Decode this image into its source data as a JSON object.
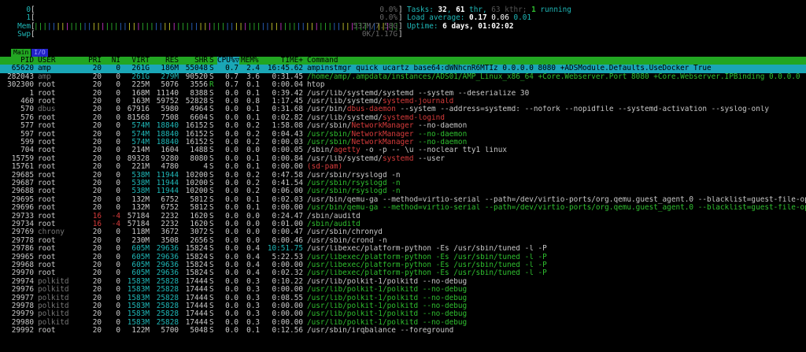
{
  "meters": [
    {
      "label": "0",
      "value": "0.0%",
      "kind": "cpu",
      "fill_fraction": 0.0,
      "bars": ""
    },
    {
      "label": "1",
      "value": "0.0%",
      "kind": "cpu",
      "fill_fraction": 0.0,
      "bars": ""
    },
    {
      "label": "Mem",
      "value": "532M/7.58G",
      "kind": "mem",
      "fill_fraction": 0.07,
      "bars": "||||||||||||||||||||||||||||||||||||||||||||||||||||||||||||||||||||||||||||||||||||||||||||||"
    },
    {
      "label": "Swp",
      "value": "0K/1.17G",
      "kind": "swp",
      "fill_fraction": 0.0,
      "bars": ""
    }
  ],
  "stats": {
    "tasks_label": "Tasks: ",
    "tasks_value": "32",
    "tasks_sep": ", ",
    "thr_value": "61",
    "thr_label": " thr, ",
    "kthr_value": "63",
    "kthr_label": " kthr; ",
    "running_value": "1",
    "running_label": " running",
    "load_label": "Load average: ",
    "load_1": "0.17",
    "load_5": "0.06",
    "load_15": "0.01",
    "uptime_label": "Uptime: ",
    "uptime_value": "6 days, 01:02:02"
  },
  "tabs": [
    {
      "label": "Main",
      "active": true
    },
    {
      "label": "I/O",
      "active": false
    }
  ],
  "columns": {
    "pid": "PID",
    "user": "USER",
    "pri": "PRI",
    "ni": "NI",
    "virt": "VIRT",
    "res": "RES",
    "shr": "SHR",
    "s": "S",
    "cpu": "CPU%▽",
    "mem": "MEM%",
    "time": "TIME+",
    "cmd": "Command"
  },
  "processes": [
    {
      "pid": "65620",
      "user": "amp",
      "pri": "20",
      "ni": "0",
      "virt": "261G",
      "res": "186M",
      "shr": "55048",
      "s": "S",
      "cpu": "0.7",
      "mem": "2.4",
      "time": "16:45.62",
      "cmd": "ampinstmgr quick ucartz base64:dWNhcnR6MTIz 0.0.0.0 8080 +ADSModule.Defaults.UseDocker True",
      "selected": true,
      "user_style": "",
      "virt_style": "",
      "cmd_style": ""
    },
    {
      "pid": "282043",
      "user": "amp",
      "pri": "20",
      "ni": "0",
      "virt": "261G",
      "res": "279M",
      "shr": "90520",
      "s": "S",
      "cpu": "0.7",
      "mem": "3.6",
      "time": "0:31.45",
      "cmd": "/home/amp/.ampdata/instances/ADS01/AMP_Linux_x86_64 +Core.Webserver.Port 8080 +Core.Webserver.IPBinding 0.0.0.0",
      "selected": false,
      "user_style": "dim",
      "virt_style": "cyan",
      "cmd_style": "green"
    },
    {
      "pid": "302300",
      "user": "root",
      "pri": "20",
      "ni": "0",
      "virt": "225M",
      "res": "5076",
      "shr": "3556",
      "s": "R",
      "cpu": "0.7",
      "mem": "0.1",
      "time": "0:00.04",
      "cmd": "htop",
      "selected": false,
      "user_style": "",
      "virt_style": "",
      "cmd_style": ""
    },
    {
      "pid": "1",
      "user": "root",
      "pri": "20",
      "ni": "0",
      "virt": "168M",
      "res": "11140",
      "shr": "8388",
      "s": "S",
      "cpu": "0.0",
      "mem": "0.1",
      "time": "0:39.42",
      "cmd": "/usr/lib/systemd/systemd --system --deserialize 30",
      "selected": false,
      "user_style": "",
      "virt_style": "",
      "cmd_style": ""
    },
    {
      "pid": "460",
      "user": "root",
      "pri": "20",
      "ni": "0",
      "virt": "163M",
      "res": "59752",
      "shr": "52828",
      "s": "S",
      "cpu": "0.0",
      "mem": "0.8",
      "time": "1:17.45",
      "cmd": "/usr/lib/systemd/systemd-journald",
      "selected": false,
      "user_style": "",
      "virt_style": "",
      "cmd_style": "redtail",
      "cmd_prefix": "/usr/lib/systemd/",
      "cmd_tail": "systemd-journald"
    },
    {
      "pid": "570",
      "user": "dbus",
      "pri": "20",
      "ni": "0",
      "virt": "67916",
      "res": "5980",
      "shr": "4964",
      "s": "S",
      "cpu": "0.0",
      "mem": "0.1",
      "time": "0:31.68",
      "cmd": "/usr/bin/dbus-daemon --system --address=systemd: --nofork --nopidfile --systemd-activation --syslog-only",
      "selected": false,
      "user_style": "dim",
      "virt_style": "",
      "cmd_style": "redmid",
      "cmd_prefix": "/usr/bin/",
      "cmd_tail": "dbus-daemon",
      "cmd_rest": " --system --address=systemd: --nofork --nopidfile --systemd-activation --syslog-only"
    },
    {
      "pid": "576",
      "user": "root",
      "pri": "20",
      "ni": "0",
      "virt": "81568",
      "res": "7508",
      "shr": "6604",
      "s": "S",
      "cpu": "0.0",
      "mem": "0.1",
      "time": "0:02.82",
      "cmd": "/usr/lib/systemd/systemd-logind",
      "selected": false,
      "user_style": "",
      "virt_style": "",
      "cmd_style": "redtail",
      "cmd_prefix": "/usr/lib/systemd/",
      "cmd_tail": "systemd-logind"
    },
    {
      "pid": "577",
      "user": "root",
      "pri": "20",
      "ni": "0",
      "virt": "574M",
      "res": "18840",
      "shr": "16152",
      "s": "S",
      "cpu": "0.0",
      "mem": "0.2",
      "time": "1:58.08",
      "cmd": "/usr/sbin/NetworkManager --no-daemon",
      "selected": false,
      "user_style": "",
      "virt_style": "cyan",
      "cmd_style": "redmid",
      "cmd_prefix": "/usr/sbin/",
      "cmd_tail": "NetworkManager",
      "cmd_rest": " --no-daemon"
    },
    {
      "pid": "597",
      "user": "root",
      "pri": "20",
      "ni": "0",
      "virt": "574M",
      "res": "18840",
      "shr": "16152",
      "s": "S",
      "cpu": "0.0",
      "mem": "0.2",
      "time": "0:04.43",
      "cmd": "/usr/sbin/NetworkManager --no-daemon",
      "selected": false,
      "user_style": "",
      "virt_style": "cyan",
      "cmd_style": "greenred",
      "cmd_prefix": "/usr/sbin/",
      "cmd_tail": "NetworkManager",
      "cmd_rest": " --no-daemon"
    },
    {
      "pid": "599",
      "user": "root",
      "pri": "20",
      "ni": "0",
      "virt": "574M",
      "res": "18840",
      "shr": "16152",
      "s": "S",
      "cpu": "0.0",
      "mem": "0.2",
      "time": "0:00.03",
      "cmd": "/usr/sbin/NetworkManager --no-daemon",
      "selected": false,
      "user_style": "",
      "virt_style": "cyan",
      "cmd_style": "greenred",
      "cmd_prefix": "/usr/sbin/",
      "cmd_tail": "NetworkManager",
      "cmd_rest": " --no-daemon"
    },
    {
      "pid": "704",
      "user": "root",
      "pri": "20",
      "ni": "0",
      "virt": "214M",
      "res": "1604",
      "shr": "1488",
      "s": "S",
      "cpu": "0.0",
      "mem": "0.0",
      "time": "0:00.05",
      "cmd": "/sbin/agetty -o -p -- \\u --noclear tty1 linux",
      "selected": false,
      "user_style": "",
      "virt_style": "",
      "cmd_style": "redmid",
      "cmd_prefix": "/sbin/",
      "cmd_tail": "agetty",
      "cmd_rest": " -o -p -- \\u --noclear tty1 linux"
    },
    {
      "pid": "15759",
      "user": "root",
      "pri": "20",
      "ni": "0",
      "virt": "89328",
      "res": "9280",
      "shr": "8080",
      "s": "S",
      "cpu": "0.0",
      "mem": "0.1",
      "time": "0:00.84",
      "cmd": "/usr/lib/systemd/systemd --user",
      "selected": false,
      "user_style": "",
      "virt_style": "",
      "cmd_style": "redmid",
      "cmd_prefix": "/usr/lib/systemd/",
      "cmd_tail": "systemd",
      "cmd_rest": " --user"
    },
    {
      "pid": "15761",
      "user": "root",
      "pri": "20",
      "ni": "0",
      "virt": "221M",
      "res": "4780",
      "shr": "4",
      "s": "S",
      "cpu": "0.0",
      "mem": "0.1",
      "time": "0:00.00",
      "cmd": "(sd-pam)",
      "selected": false,
      "user_style": "",
      "virt_style": "",
      "cmd_style": "red"
    },
    {
      "pid": "29685",
      "user": "root",
      "pri": "20",
      "ni": "0",
      "virt": "538M",
      "res": "11944",
      "shr": "10200",
      "s": "S",
      "cpu": "0.0",
      "mem": "0.2",
      "time": "0:47.58",
      "cmd": "/usr/sbin/rsyslogd -n",
      "selected": false,
      "user_style": "",
      "virt_style": "cyan",
      "cmd_style": ""
    },
    {
      "pid": "29687",
      "user": "root",
      "pri": "20",
      "ni": "0",
      "virt": "538M",
      "res": "11944",
      "shr": "10200",
      "s": "S",
      "cpu": "0.0",
      "mem": "0.2",
      "time": "0:41.54",
      "cmd": "/usr/sbin/rsyslogd -n",
      "selected": false,
      "user_style": "",
      "virt_style": "cyan",
      "cmd_style": "green"
    },
    {
      "pid": "29688",
      "user": "root",
      "pri": "20",
      "ni": "0",
      "virt": "538M",
      "res": "11944",
      "shr": "10200",
      "s": "S",
      "cpu": "0.0",
      "mem": "0.2",
      "time": "0:06.00",
      "cmd": "/usr/sbin/rsyslogd -n",
      "selected": false,
      "user_style": "",
      "virt_style": "cyan",
      "cmd_style": "green"
    },
    {
      "pid": "29695",
      "user": "root",
      "pri": "20",
      "ni": "0",
      "virt": "132M",
      "res": "6752",
      "shr": "5812",
      "s": "S",
      "cpu": "0.0",
      "mem": "0.1",
      "time": "0:02.03",
      "cmd": "/usr/bin/qemu-ga --method=virtio-serial --path=/dev/virtio-ports/org.qemu.guest_agent.0 --blacklist=guest-file-open",
      "selected": false,
      "user_style": "",
      "virt_style": "",
      "cmd_style": ""
    },
    {
      "pid": "29696",
      "user": "root",
      "pri": "20",
      "ni": "0",
      "virt": "132M",
      "res": "6752",
      "shr": "5812",
      "s": "S",
      "cpu": "0.0",
      "mem": "0.1",
      "time": "0:00.00",
      "cmd": "/usr/bin/qemu-ga --method=virtio-serial --path=/dev/virtio-ports/org.qemu.guest_agent.0 --blacklist=guest-file-open",
      "selected": false,
      "user_style": "",
      "virt_style": "",
      "cmd_style": "green"
    },
    {
      "pid": "29733",
      "user": "root",
      "pri": "16",
      "ni": "-4",
      "virt": "57184",
      "res": "2232",
      "shr": "1620",
      "s": "S",
      "cpu": "0.0",
      "mem": "0.0",
      "time": "0:24.47",
      "cmd": "/sbin/auditd",
      "selected": false,
      "user_style": "",
      "virt_style": "",
      "cmd_style": "",
      "ni_red": true
    },
    {
      "pid": "29734",
      "user": "root",
      "pri": "16",
      "ni": "-4",
      "virt": "57184",
      "res": "2232",
      "shr": "1620",
      "s": "S",
      "cpu": "0.0",
      "mem": "0.0",
      "time": "0:01.00",
      "cmd": "/sbin/auditd",
      "selected": false,
      "user_style": "",
      "virt_style": "",
      "cmd_style": "green",
      "ni_red": true
    },
    {
      "pid": "29769",
      "user": "chrony",
      "pri": "20",
      "ni": "0",
      "virt": "118M",
      "res": "3672",
      "shr": "3072",
      "s": "S",
      "cpu": "0.0",
      "mem": "0.0",
      "time": "0:00.47",
      "cmd": "/usr/sbin/chronyd",
      "selected": false,
      "user_style": "dim",
      "virt_style": "",
      "cmd_style": ""
    },
    {
      "pid": "29778",
      "user": "root",
      "pri": "20",
      "ni": "0",
      "virt": "230M",
      "res": "3508",
      "shr": "2656",
      "s": "S",
      "cpu": "0.0",
      "mem": "0.0",
      "time": "0:00.46",
      "cmd": "/usr/sbin/crond -n",
      "selected": false,
      "user_style": "",
      "virt_style": "",
      "cmd_style": ""
    },
    {
      "pid": "29786",
      "user": "root",
      "pri": "20",
      "ni": "0",
      "virt": "605M",
      "res": "29636",
      "shr": "15824",
      "s": "S",
      "cpu": "0.0",
      "mem": "0.4",
      "time": "10:51.75",
      "cmd": "/usr/libexec/platform-python -Es /usr/sbin/tuned -l -P",
      "selected": false,
      "user_style": "",
      "virt_style": "cyan",
      "cmd_style": "",
      "time_cyan": true
    },
    {
      "pid": "29965",
      "user": "root",
      "pri": "20",
      "ni": "0",
      "virt": "605M",
      "res": "29636",
      "shr": "15824",
      "s": "S",
      "cpu": "0.0",
      "mem": "0.4",
      "time": "5:22.53",
      "cmd": "/usr/libexec/platform-python -Es /usr/sbin/tuned -l -P",
      "selected": false,
      "user_style": "",
      "virt_style": "cyan",
      "cmd_style": "green"
    },
    {
      "pid": "29968",
      "user": "root",
      "pri": "20",
      "ni": "0",
      "virt": "605M",
      "res": "29636",
      "shr": "15824",
      "s": "S",
      "cpu": "0.0",
      "mem": "0.4",
      "time": "0:00.00",
      "cmd": "/usr/libexec/platform-python -Es /usr/sbin/tuned -l -P",
      "selected": false,
      "user_style": "",
      "virt_style": "cyan",
      "cmd_style": "green"
    },
    {
      "pid": "29970",
      "user": "root",
      "pri": "20",
      "ni": "0",
      "virt": "605M",
      "res": "29636",
      "shr": "15824",
      "s": "S",
      "cpu": "0.0",
      "mem": "0.4",
      "time": "0:02.32",
      "cmd": "/usr/libexec/platform-python -Es /usr/sbin/tuned -l -P",
      "selected": false,
      "user_style": "",
      "virt_style": "cyan",
      "cmd_style": "green"
    },
    {
      "pid": "29974",
      "user": "polkitd",
      "pri": "20",
      "ni": "0",
      "virt": "1583M",
      "res": "25828",
      "shr": "17444",
      "s": "S",
      "cpu": "0.0",
      "mem": "0.3",
      "time": "0:10.22",
      "cmd": "/usr/lib/polkit-1/polkitd --no-debug",
      "selected": false,
      "user_style": "dim",
      "virt_style": "cyan",
      "cmd_style": ""
    },
    {
      "pid": "29976",
      "user": "polkitd",
      "pri": "20",
      "ni": "0",
      "virt": "1583M",
      "res": "25828",
      "shr": "17444",
      "s": "S",
      "cpu": "0.0",
      "mem": "0.3",
      "time": "0:00.00",
      "cmd": "/usr/lib/polkit-1/polkitd --no-debug",
      "selected": false,
      "user_style": "dim",
      "virt_style": "cyan",
      "cmd_style": "green"
    },
    {
      "pid": "29977",
      "user": "polkitd",
      "pri": "20",
      "ni": "0",
      "virt": "1583M",
      "res": "25828",
      "shr": "17444",
      "s": "S",
      "cpu": "0.0",
      "mem": "0.3",
      "time": "0:08.55",
      "cmd": "/usr/lib/polkit-1/polkitd --no-debug",
      "selected": false,
      "user_style": "dim",
      "virt_style": "cyan",
      "cmd_style": "green"
    },
    {
      "pid": "29978",
      "user": "polkitd",
      "pri": "20",
      "ni": "0",
      "virt": "1583M",
      "res": "25828",
      "shr": "17444",
      "s": "S",
      "cpu": "0.0",
      "mem": "0.3",
      "time": "0:00.00",
      "cmd": "/usr/lib/polkit-1/polkitd --no-debug",
      "selected": false,
      "user_style": "dim",
      "virt_style": "cyan",
      "cmd_style": "green"
    },
    {
      "pid": "29979",
      "user": "polkitd",
      "pri": "20",
      "ni": "0",
      "virt": "1583M",
      "res": "25828",
      "shr": "17444",
      "s": "S",
      "cpu": "0.0",
      "mem": "0.3",
      "time": "0:00.00",
      "cmd": "/usr/lib/polkit-1/polkitd --no-debug",
      "selected": false,
      "user_style": "dim",
      "virt_style": "cyan",
      "cmd_style": "green"
    },
    {
      "pid": "29980",
      "user": "polkitd",
      "pri": "20",
      "ni": "0",
      "virt": "1583M",
      "res": "25828",
      "shr": "17444",
      "s": "S",
      "cpu": "0.0",
      "mem": "0.3",
      "time": "0:00.00",
      "cmd": "/usr/lib/polkit-1/polkitd --no-debug",
      "selected": false,
      "user_style": "dim",
      "virt_style": "cyan",
      "cmd_style": "green"
    },
    {
      "pid": "29992",
      "user": "root",
      "pri": "20",
      "ni": "0",
      "virt": "122M",
      "res": "5700",
      "shr": "5048",
      "s": "S",
      "cpu": "0.0",
      "mem": "0.1",
      "time": "0:12.56",
      "cmd": "/usr/sbin/irqbalance --foreground",
      "selected": false,
      "user_style": "",
      "virt_style": "",
      "cmd_style": ""
    }
  ],
  "colors": {
    "background": "#000000",
    "header_bg": "#22a622",
    "selected_bg": "#1aa6b6",
    "cyan": "#1fb7b7",
    "green": "#2fbf2f",
    "red": "#d63b3b",
    "tab_active": "#22a622",
    "tab_inactive": "#2323c8"
  }
}
